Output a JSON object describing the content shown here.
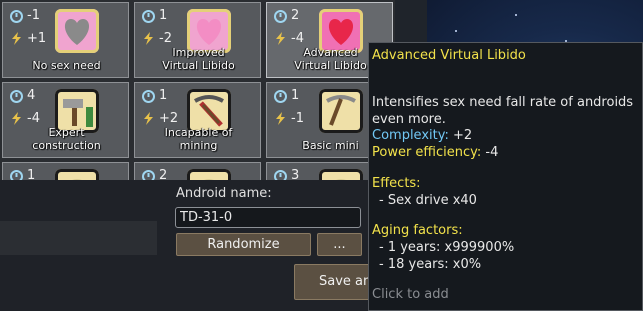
{
  "genes": [
    {
      "complexity": "-1",
      "power": "+1",
      "label_lines": [
        "No sex need"
      ],
      "icon": "grey-heart-icon",
      "color": "#f0a4cf"
    },
    {
      "complexity": "1",
      "power": "-2",
      "label_lines": [
        "Improved",
        "Virtual Libido"
      ],
      "icon": "pink-heart-icon",
      "color": "#f0a4cf"
    },
    {
      "complexity": "2",
      "power": "-4",
      "label_lines": [
        "Advanced",
        "Virtual Libido"
      ],
      "icon": "red-heart-icon",
      "color": "#f070b4"
    },
    {
      "complexity": "4",
      "power": "-4",
      "label_lines": [
        "Expert",
        "construction"
      ],
      "icon": "hammer-icon",
      "color": "#efe0a8"
    },
    {
      "complexity": "1",
      "power": "+2",
      "label_lines": [
        "Incapable of",
        "mining"
      ],
      "icon": "broken-pickaxe-icon",
      "color": "#efe0a8"
    },
    {
      "complexity": "1",
      "power": "-1",
      "label_lines": [
        "Basic mini"
      ],
      "icon": "pickaxe-icon",
      "color": "#efe0a8"
    },
    {
      "complexity": "1",
      "power": "",
      "label_lines": [],
      "icon": "gear-icon",
      "color": "#efe0a8"
    },
    {
      "complexity": "2",
      "power": "",
      "label_lines": [],
      "icon": "gear-icon",
      "color": "#efe0a8"
    },
    {
      "complexity": "3",
      "power": "",
      "label_lines": [],
      "icon": "gear-icon",
      "color": "#efe0a8"
    }
  ],
  "form": {
    "name_label": "Android name:",
    "name_value": "TD-31-0",
    "randomize_label": "Randomize",
    "more_label": "...",
    "save_label": "Save an"
  },
  "tooltip": {
    "title": "Advanced Virtual Libido",
    "description_lines": [
      "Intensifies sex need fall rate of androids",
      "even more."
    ],
    "complexity_label": "Complexity:",
    "complexity_value": " +2",
    "power_label": "Power efficiency:",
    "power_value": " -4",
    "effects_label": "Effects:",
    "effects": [
      "- Sex drive x40"
    ],
    "aging_label": "Aging factors:",
    "aging": [
      "- 1 years: x999900%",
      "- 18 years: x0%"
    ],
    "hint": "Click to add"
  },
  "colors": {
    "accent_yellow": "#f2e24b",
    "accent_cyan": "#72c8f5",
    "button_brown": "#5b5042"
  }
}
